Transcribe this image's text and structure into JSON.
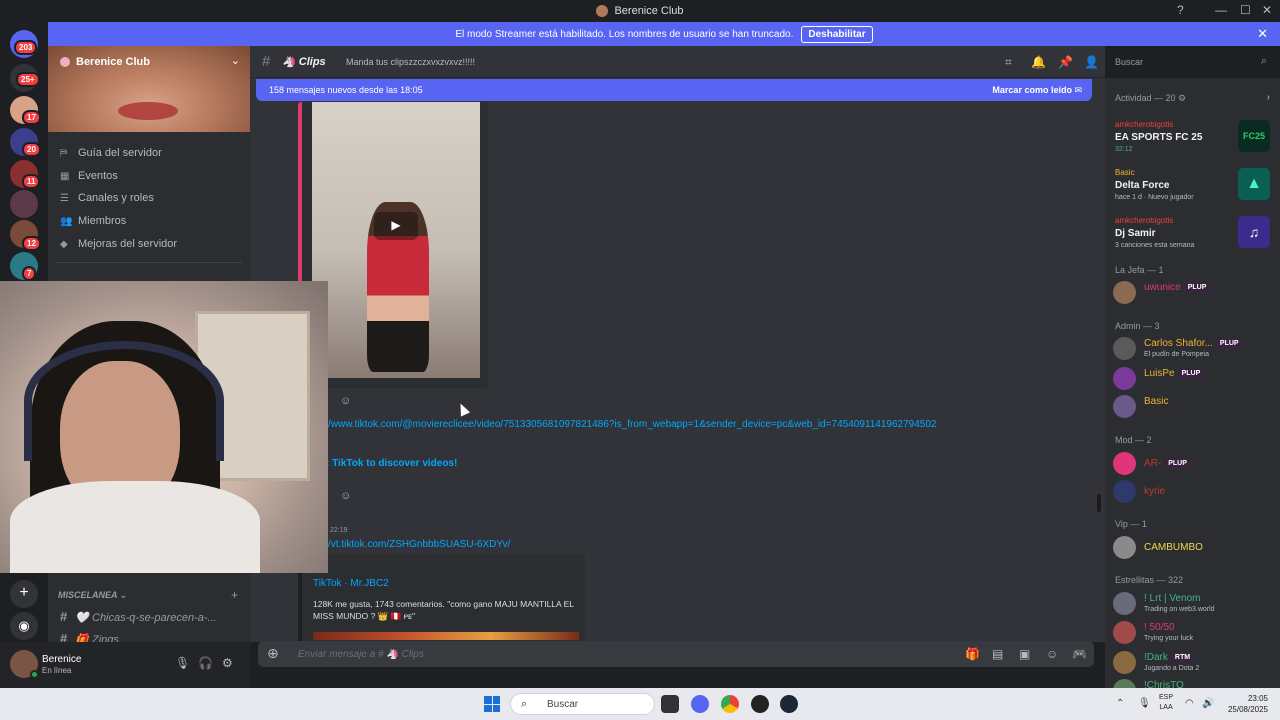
{
  "window": {
    "title": "Berenice Club",
    "help_icon": "?",
    "minimize": "—",
    "maximize": "☐",
    "close": "✕"
  },
  "banner": {
    "text": "El modo Streamer está habilitado. Los nombres de usuario se han truncado.",
    "button": "Deshabilitar",
    "close": "✕"
  },
  "rail": {
    "badges": [
      "203",
      "25+",
      "17",
      "20",
      "11",
      "12",
      "7"
    ]
  },
  "server": {
    "name": "Berenice Club",
    "nav": [
      "Guía del servidor",
      "Eventos",
      "Canales y roles",
      "Miembros",
      "Mejoras del servidor"
    ],
    "category": "MISCELANEA",
    "channels": [
      {
        "icon": "🤍",
        "name": "Chicas-q-se-parecen-a-..."
      },
      {
        "icon": "🎁",
        "name": "Zings"
      }
    ]
  },
  "user": {
    "name": "Berenice",
    "status": "En línea"
  },
  "channel": {
    "name": "Clips",
    "topic": "Manda tus clipszzczxvxzvxvz!!!!!"
  },
  "header_search": {
    "placeholder": "Buscar"
  },
  "new_messages": {
    "text": "158 mensajes nuevos desde las 18:05",
    "action": "Marcar como leído"
  },
  "chat": {
    "link1": "/www.tiktok.com/@moviereclicee/video/7513305681097821486?is_from_webapp=1&sender_device=pc&web_id=7454091141962794502",
    "embed_title1": ": TikTok to discover videos!",
    "time2": "22:19",
    "link2": "/vt.tiktok.com/ZSHGnbbbSUASU-6XDYv/",
    "embed2": {
      "provider": "TikTok · Mr.JBC2",
      "description": "128K me gusta, 1743 comentarios. \"como gano MAJU MANTILLA EL MISS MUNDO ? 👑 🇵🇪 ᴘᴇ\""
    }
  },
  "composer": {
    "placeholder": "Enviar mensaje a #",
    "channel": "Clips"
  },
  "members": {
    "activity_header": "Actividad — 20",
    "activities": [
      {
        "user": "amkcherobigotis",
        "game": "EA SPORTS FC 25",
        "status": "32:12",
        "color": "#0a2b20",
        "art": "FC25"
      },
      {
        "user": "Basic",
        "game": "Delta Force",
        "status": "hace 1 d · Nuevo jugador",
        "color": "#0b5e52",
        "art": "▲"
      },
      {
        "user": "amkcherobigotis",
        "game": "Dj Samir",
        "status": "3 canciones esta semana",
        "color": "#3a2b8c",
        "art": "♫"
      }
    ],
    "groups": [
      {
        "title": "La Jefa — 1",
        "rows": [
          {
            "name": "uwunice",
            "tag": "PLUP",
            "sub": "",
            "color": "#e0357a"
          }
        ]
      },
      {
        "title": "Admin — 3",
        "rows": [
          {
            "name": "Carlos Shafor...",
            "tag": "PLUP",
            "sub": "El pudín de Pompeia",
            "color": "#f0b232"
          },
          {
            "name": "LuisPe",
            "tag": "PLUP",
            "sub": "",
            "color": "#f0b232"
          },
          {
            "name": "Basic",
            "tag": "",
            "sub": "",
            "color": "#f0b232"
          }
        ]
      },
      {
        "title": "Mod — 2",
        "rows": [
          {
            "name": "AR-",
            "tag": "PLUP",
            "sub": "",
            "color": "#c0392b"
          },
          {
            "name": "kyrie",
            "tag": "",
            "sub": "",
            "color": "#c0392b"
          }
        ]
      },
      {
        "title": "Vip — 1",
        "rows": [
          {
            "name": "CAMBUMBO",
            "tag": "",
            "sub": "",
            "color": "#f1d74b"
          }
        ]
      },
      {
        "title": "Estrellitas — 322",
        "rows": [
          {
            "name": "! Lrt | Venom",
            "tag": "",
            "sub": "Trading on web3.world",
            "color": "#43b581"
          },
          {
            "name": "! 50/50",
            "tag": "",
            "sub": "Trying your luck",
            "color": "#e0357a"
          },
          {
            "name": "!Dark",
            "tag": "RTM",
            "sub": "Jugando a Dota 2",
            "color": "#43b581"
          },
          {
            "name": "!ChrisTO",
            "tag": "",
            "sub": "",
            "color": "#43b581"
          }
        ]
      }
    ]
  },
  "taskbar": {
    "search": "Buscar",
    "lang": [
      "ESP",
      "LAA"
    ],
    "time": "23:05",
    "date": "25/08/2025"
  }
}
